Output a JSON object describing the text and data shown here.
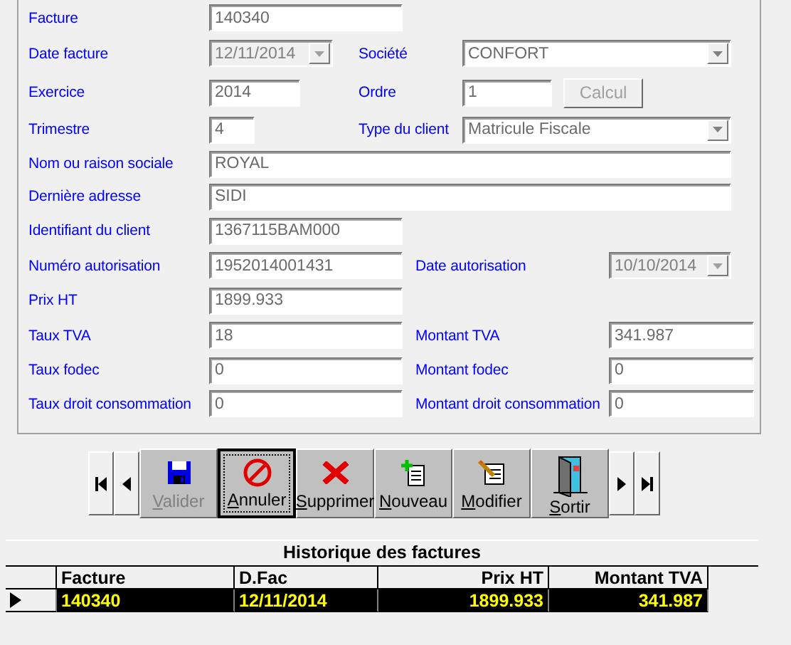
{
  "form": {
    "rows": [
      {
        "fields": [
          {
            "label": "Facture",
            "value": "140340",
            "kind": "text",
            "disabled": false
          }
        ]
      },
      {
        "fields": [
          {
            "label": "Date facture",
            "value": "12/11/2014",
            "kind": "combo",
            "disabled": true
          },
          {
            "label": "Société",
            "value": "CONFORT",
            "kind": "combo",
            "disabled": false
          }
        ]
      },
      {
        "fields": [
          {
            "label": "Exercice",
            "value": "2014",
            "kind": "text",
            "disabled": false
          },
          {
            "label": "Ordre",
            "value": "1",
            "kind": "text",
            "disabled": false
          }
        ],
        "button": {
          "label": "Calcul",
          "disabled": true
        }
      },
      {
        "fields": [
          {
            "label": "Trimestre",
            "value": "4",
            "kind": "text",
            "disabled": false
          },
          {
            "label": "Type du client",
            "value": "Matricule Fiscale",
            "kind": "combo",
            "disabled": false
          }
        ]
      },
      {
        "fields": [
          {
            "label": "Nom ou raison sociale",
            "value": "ROYAL",
            "kind": "text",
            "disabled": false
          }
        ]
      },
      {
        "fields": [
          {
            "label": "Dernière adresse",
            "value": "SIDI",
            "kind": "text",
            "disabled": false
          }
        ]
      },
      {
        "fields": [
          {
            "label": "Identifiant du client",
            "value": "1367115BAM000",
            "kind": "text",
            "disabled": false
          }
        ]
      },
      {
        "fields": [
          {
            "label": "Numéro autorisation",
            "value": "1952014001431",
            "kind": "text",
            "disabled": false
          },
          {
            "label": "Date autorisation",
            "value": "10/10/2014",
            "kind": "combo",
            "disabled": true
          }
        ]
      },
      {
        "fields": [
          {
            "label": "Prix HT",
            "value": "1899.933",
            "kind": "text",
            "disabled": false
          }
        ]
      },
      {
        "fields": [
          {
            "label": "Taux TVA",
            "value": "18",
            "kind": "text",
            "disabled": false
          },
          {
            "label": "Montant TVA",
            "value": "341.987",
            "kind": "text",
            "disabled": false
          }
        ]
      },
      {
        "fields": [
          {
            "label": "Taux fodec",
            "value": "0",
            "kind": "text",
            "disabled": false
          },
          {
            "label": "Montant fodec",
            "value": "0",
            "kind": "text",
            "disabled": false
          }
        ]
      },
      {
        "fields": [
          {
            "label": "Taux droit consommation",
            "value": "0",
            "kind": "text",
            "disabled": false
          },
          {
            "label": "Montant droit consommation",
            "value": "0",
            "kind": "text",
            "disabled": false
          }
        ]
      }
    ]
  },
  "toolbar": {
    "buttons": [
      {
        "label": "Valider",
        "kind": "save",
        "disabled": true,
        "focused": false
      },
      {
        "label": "Annuler",
        "kind": "cancel",
        "disabled": false,
        "focused": true
      },
      {
        "label": "Supprimer",
        "kind": "delete",
        "disabled": false,
        "focused": false
      },
      {
        "label": "Nouveau",
        "kind": "new",
        "disabled": false,
        "focused": false
      },
      {
        "label": "Modifier",
        "kind": "edit",
        "disabled": false,
        "focused": false
      },
      {
        "label": "Sortir",
        "kind": "exit",
        "disabled": false,
        "focused": false
      }
    ]
  },
  "history": {
    "title": "Historique des factures",
    "columns": [
      {
        "label": "Facture",
        "kind": "text"
      },
      {
        "label": "D.Fac",
        "kind": "text"
      },
      {
        "label": "Prix HT",
        "kind": "number"
      },
      {
        "label": "Montant TVA",
        "kind": "number"
      }
    ],
    "rows": [
      {
        "cells": [
          "140340",
          "12/11/2014",
          "1899.933",
          "341.987"
        ],
        "selected": true
      }
    ]
  }
}
